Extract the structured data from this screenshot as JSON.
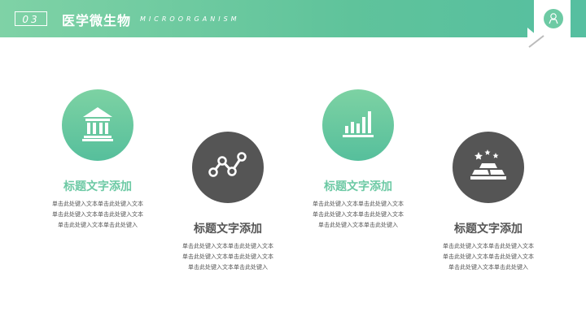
{
  "header": {
    "number": "03",
    "title": "医学微生物",
    "subtitle": "MICROORGANISM"
  },
  "logo": {
    "icon": "hospital-logo-icon"
  },
  "colors": {
    "accent": "#5fc39b",
    "dark": "#555555"
  },
  "items": [
    {
      "icon": "building-icon",
      "title": "标题文字添加",
      "lines": [
        "单击此处键入文本单击此处键入文本",
        "单击此处键入文本单击此处键入文本",
        "单击此处键入文本单击此处键入"
      ]
    },
    {
      "icon": "line-chart-icon",
      "title": "标题文字添加",
      "lines": [
        "单击此处键入文本单击此处键入文本",
        "单击此处键入文本单击此处键入文本",
        "单击此处键入文本单击此处键入"
      ]
    },
    {
      "icon": "bar-chart-icon",
      "title": "标题文字添加",
      "lines": [
        "单击此处键入文本单击此处键入文本",
        "单击此处键入文本单击此处键入文本",
        "单击此处键入文本单击此处键入"
      ]
    },
    {
      "icon": "gold-bars-icon",
      "title": "标题文字添加",
      "lines": [
        "单击此处键入文本单击此处键入文本",
        "单击此处键入文本单击此处键入文本",
        "单击此处键入文本单击此处键入"
      ]
    }
  ]
}
